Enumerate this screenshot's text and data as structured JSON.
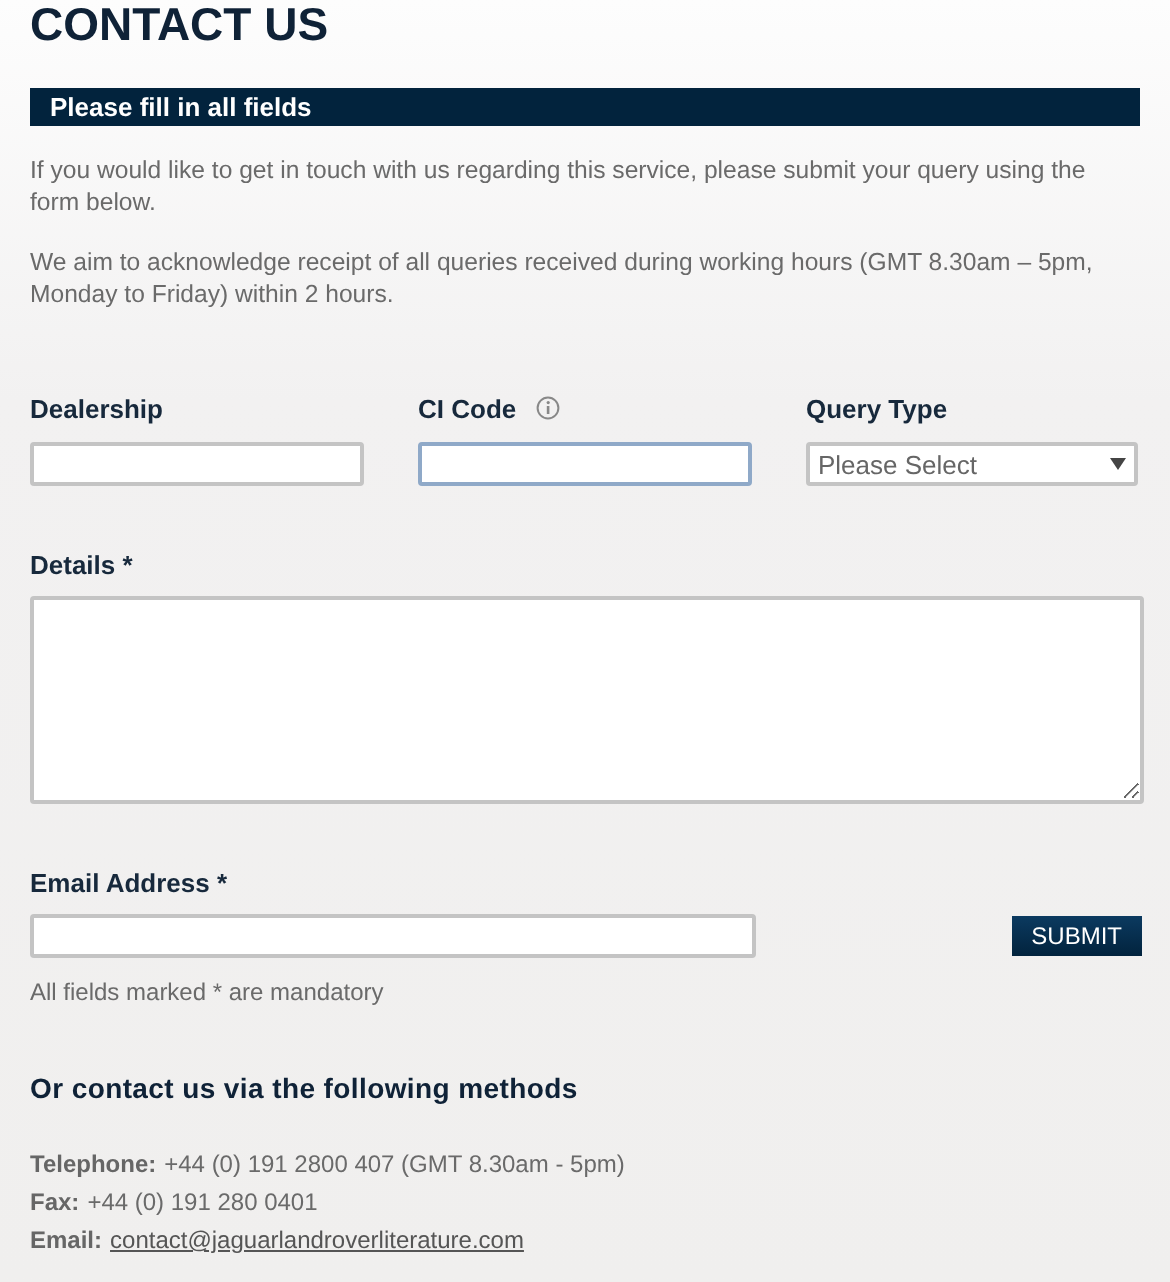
{
  "title": "CONTACT US",
  "banner": "Please fill in all fields",
  "intro": [
    "If you would like to get in touch with us regarding this service, please submit your query using the form below.",
    "We aim to acknowledge receipt of all queries received during working hours (GMT 8.30am – 5pm, Monday to Friday) within 2 hours."
  ],
  "fields": [
    {
      "kind": "text",
      "label": "Dealership",
      "focused": false
    },
    {
      "kind": "text",
      "label": "CI Code",
      "focused": true,
      "info_icon": true
    },
    {
      "kind": "select",
      "label": "Query Type",
      "placeholder": "Please Select",
      "focused": false
    }
  ],
  "details": {
    "label": "Details *"
  },
  "email": {
    "label": "Email Address *"
  },
  "submit": "SUBMIT",
  "note": "All fields marked * are mandatory",
  "contact_heading": "Or contact us via the following methods",
  "contact_methods": [
    {
      "label": "Telephone:",
      "value": "+44 (0) 191 2800 407 (GMT 8.30am - 5pm)",
      "kind": "text"
    },
    {
      "label": "Fax:",
      "value": "+44 (0) 191 280 0401",
      "kind": "text"
    },
    {
      "label": "Email:",
      "value": "contact@jaguarlandroverliterature.com",
      "kind": "link"
    }
  ]
}
